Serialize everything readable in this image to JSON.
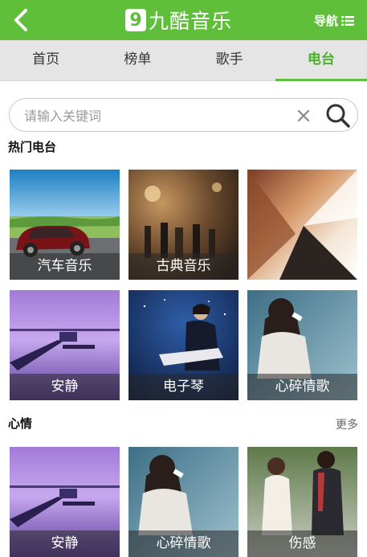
{
  "header": {
    "logo_mark": "9",
    "logo_text": "九酷音乐",
    "nav_label": "导航",
    "bg_color": "#5fbf3a"
  },
  "tabs": [
    {
      "label": "首页"
    },
    {
      "label": "榜单"
    },
    {
      "label": "歌手"
    },
    {
      "label": "电台",
      "active": true
    }
  ],
  "search": {
    "placeholder": "请输入关键词",
    "value": ""
  },
  "hot_section": {
    "title": "热门电台",
    "items": [
      {
        "label": "汽车音乐"
      },
      {
        "label": "古典音乐"
      },
      {
        "label": ""
      },
      {
        "label": "安静"
      },
      {
        "label": "电子琴"
      },
      {
        "label": "心碎情歌"
      }
    ]
  },
  "mood_section": {
    "title": "心情",
    "more_label": "更多",
    "items": [
      {
        "label": "安静"
      },
      {
        "label": "心碎情歌"
      },
      {
        "label": "伤感"
      }
    ]
  }
}
